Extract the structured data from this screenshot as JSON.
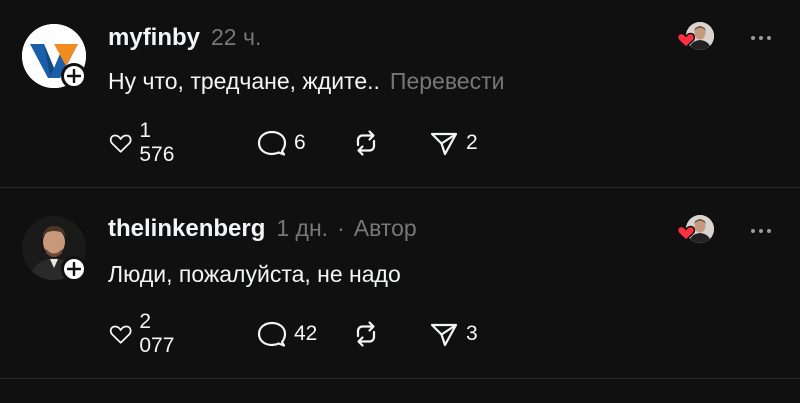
{
  "posts": [
    {
      "username": "myfinby",
      "time": "22 ч.",
      "text": "Ну что, тредчане, ждите..",
      "translate_label": "Перевести",
      "avatar_icon": "myfinby-logo",
      "likes": "1 576",
      "replies": "6",
      "shares": "2"
    },
    {
      "username": "thelinkenberg",
      "time": "1 дн.",
      "separator": "·",
      "author_label": "Автор",
      "text": "Люди, пожалуйста, не надо",
      "avatar_icon": "user-photo",
      "likes": "2 077",
      "replies": "42",
      "shares": "3"
    }
  ],
  "colors": {
    "background": "#101010",
    "text_primary": "#f3f5f7",
    "text_secondary": "#777777",
    "heart": "#ff3040",
    "divider": "#2a2a2a"
  },
  "icons": {
    "like": "heart-outline-icon",
    "reply": "speech-bubble-icon",
    "repost": "repost-arrows-icon",
    "share": "paper-plane-icon",
    "more": "more-dots-icon",
    "follow": "plus-icon",
    "liked_by": "red-heart-icon"
  }
}
